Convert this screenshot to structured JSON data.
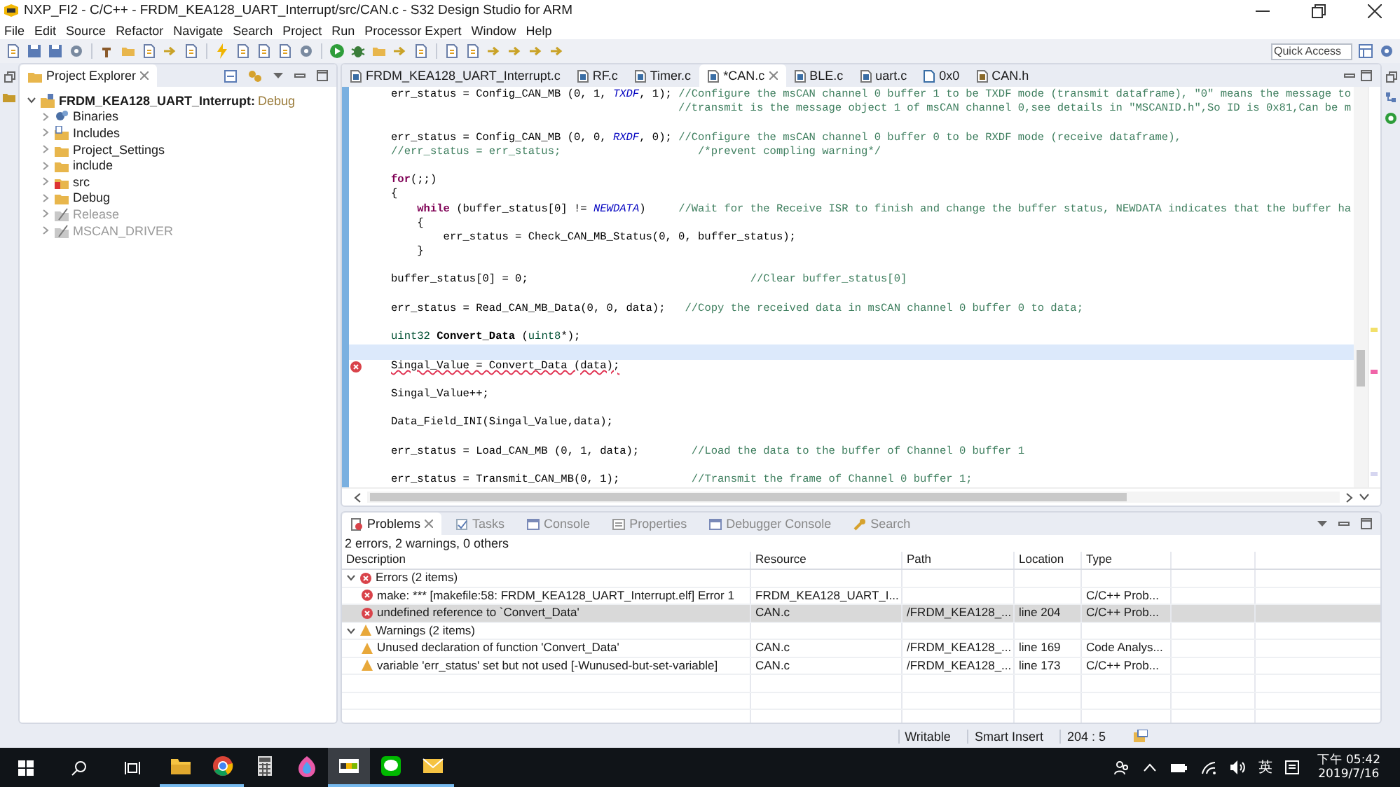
{
  "window": {
    "title": "NXP_FI2 - C/C++ - FRDM_KEA128_UART_Interrupt/src/CAN.c - S32 Design Studio for ARM"
  },
  "menu": [
    "File",
    "Edit",
    "Source",
    "Refactor",
    "Navigate",
    "Search",
    "Project",
    "Run",
    "Processor Expert",
    "Window",
    "Help"
  ],
  "quick_access": {
    "placeholder": "Quick Access"
  },
  "project_explorer": {
    "title": "Project Explorer",
    "root": {
      "label": "FRDM_KEA128_UART_Interrupt:",
      "config": "Debug",
      "expanded": true,
      "children": [
        {
          "label": "Binaries",
          "kind": "binaries",
          "disabled": false
        },
        {
          "label": "Includes",
          "kind": "includes",
          "disabled": false
        },
        {
          "label": "Project_Settings",
          "kind": "folder",
          "disabled": false
        },
        {
          "label": "include",
          "kind": "folder",
          "disabled": false
        },
        {
          "label": "src",
          "kind": "source",
          "disabled": false
        },
        {
          "label": "Debug",
          "kind": "folder",
          "disabled": false
        },
        {
          "label": "Release",
          "kind": "excluded",
          "disabled": true
        },
        {
          "label": "MSCAN_DRIVER",
          "kind": "excluded",
          "disabled": true
        }
      ]
    }
  },
  "editor": {
    "tabs": [
      {
        "label": "FRDM_KEA128_UART_Interrupt.c",
        "kind": "source",
        "selected": false
      },
      {
        "label": "RF.c",
        "kind": "source",
        "selected": false
      },
      {
        "label": "Timer.c",
        "kind": "source",
        "selected": false
      },
      {
        "label": "*CAN.c",
        "kind": "source",
        "selected": true
      },
      {
        "label": "BLE.c",
        "kind": "source",
        "selected": false
      },
      {
        "label": "uart.c",
        "kind": "source",
        "selected": false
      },
      {
        "label": "0x0",
        "kind": "binary",
        "selected": false
      },
      {
        "label": "CAN.h",
        "kind": "header",
        "selected": false
      }
    ],
    "lines": [
      {
        "kind": "code",
        "current": false,
        "error": false,
        "segments": [
          {
            "kind": "text",
            "t": "err_status = Config_CAN_MB (0, 1, "
          },
          {
            "kind": "macro",
            "t": "TXDF"
          },
          {
            "kind": "text",
            "t": ", 1); "
          },
          {
            "kind": "comment",
            "t": "//Configure the msCAN channel 0 buffer 1 to be TXDF mode (transmit dataframe), \"0\" means the message to"
          }
        ]
      },
      {
        "kind": "code",
        "current": false,
        "error": false,
        "segments": [
          {
            "kind": "comment",
            "t": "                                            //transmit is the message object 1 of msCAN channel 0,see details in \"MSCANID.h\",So ID is 0x81,Can be m"
          }
        ]
      },
      {
        "kind": "blank",
        "current": false,
        "error": false
      },
      {
        "kind": "code",
        "current": false,
        "error": false,
        "segments": [
          {
            "kind": "text",
            "t": "err_status = Config_CAN_MB (0, 0, "
          },
          {
            "kind": "macro",
            "t": "RXDF"
          },
          {
            "kind": "text",
            "t": ", 0); "
          },
          {
            "kind": "comment",
            "t": "//Configure the msCAN channel 0 buffer 0 to be RXDF mode (receive dataframe),"
          }
        ]
      },
      {
        "kind": "code",
        "current": false,
        "error": false,
        "segments": [
          {
            "kind": "comment",
            "t": "//err_status = err_status;                     /*prevent compling warning*/"
          }
        ]
      },
      {
        "kind": "blank",
        "current": false,
        "error": false
      },
      {
        "kind": "code",
        "current": false,
        "error": false,
        "segments": [
          {
            "kind": "keyword",
            "t": "for"
          },
          {
            "kind": "text",
            "t": "(;;)"
          }
        ]
      },
      {
        "kind": "code",
        "current": false,
        "error": false,
        "segments": [
          {
            "kind": "text",
            "t": "{"
          }
        ]
      },
      {
        "kind": "code",
        "current": false,
        "error": false,
        "segments": [
          {
            "kind": "keyword",
            "t": "    while"
          },
          {
            "kind": "text",
            "t": " (buffer_status[0] != "
          },
          {
            "kind": "macro",
            "t": "NEWDATA"
          },
          {
            "kind": "text",
            "t": ")     "
          },
          {
            "kind": "comment",
            "t": "//Wait for the Receive ISR to finish and change the buffer status, NEWDATA indicates that the buffer ha"
          }
        ]
      },
      {
        "kind": "code",
        "current": false,
        "error": false,
        "segments": [
          {
            "kind": "text",
            "t": "    {"
          }
        ]
      },
      {
        "kind": "code",
        "current": false,
        "error": false,
        "segments": [
          {
            "kind": "text",
            "t": "        err_status = Check_CAN_MB_Status(0, 0, buffer_status);"
          }
        ]
      },
      {
        "kind": "code",
        "current": false,
        "error": false,
        "segments": [
          {
            "kind": "text",
            "t": "    }"
          }
        ]
      },
      {
        "kind": "blank",
        "current": false,
        "error": false
      },
      {
        "kind": "code",
        "current": false,
        "error": false,
        "segments": [
          {
            "kind": "text",
            "t": "buffer_status[0] = 0;                                  "
          },
          {
            "kind": "comment",
            "t": "//Clear buffer_status[0]"
          }
        ]
      },
      {
        "kind": "blank",
        "current": false,
        "error": false
      },
      {
        "kind": "code",
        "current": false,
        "error": false,
        "segments": [
          {
            "kind": "text",
            "t": "err_status = Read_CAN_MB_Data(0, 0, data);   "
          },
          {
            "kind": "comment",
            "t": "//Copy the received data in msCAN channel 0 buffer 0 to data;"
          }
        ]
      },
      {
        "kind": "blank",
        "current": false,
        "error": false
      },
      {
        "kind": "code",
        "current": false,
        "error": false,
        "segments": [
          {
            "kind": "type",
            "t": "uint32 "
          },
          {
            "kind": "bold",
            "t": "Convert_Data"
          },
          {
            "kind": "text",
            "t": " ("
          },
          {
            "kind": "type",
            "t": "uint8"
          },
          {
            "kind": "text",
            "t": "*);"
          }
        ]
      },
      {
        "kind": "blank",
        "current": true,
        "error": false
      },
      {
        "kind": "code",
        "current": false,
        "error": true,
        "segments": [
          {
            "kind": "text",
            "t": "Singal_Value = Convert_Data (data);"
          }
        ]
      },
      {
        "kind": "blank",
        "current": false,
        "error": false
      },
      {
        "kind": "code",
        "current": false,
        "error": false,
        "segments": [
          {
            "kind": "text",
            "t": "Singal_Value++;"
          }
        ]
      },
      {
        "kind": "blank",
        "current": false,
        "error": false
      },
      {
        "kind": "code",
        "current": false,
        "error": false,
        "segments": [
          {
            "kind": "text",
            "t": "Data_Field_INI(Singal_Value,data);"
          }
        ]
      },
      {
        "kind": "blank",
        "current": false,
        "error": false
      },
      {
        "kind": "code",
        "current": false,
        "error": false,
        "segments": [
          {
            "kind": "text",
            "t": "err_status = Load_CAN_MB (0, 1, data);        "
          },
          {
            "kind": "comment",
            "t": "//Load the data to the buffer of Channel 0 buffer 1"
          }
        ]
      },
      {
        "kind": "blank",
        "current": false,
        "error": false
      },
      {
        "kind": "code",
        "current": false,
        "error": false,
        "segments": [
          {
            "kind": "text",
            "t": "err_status = Transmit_CAN_MB(0, 1);           "
          },
          {
            "kind": "comment",
            "t": "//Transmit the frame of Channel 0 buffer 1;"
          }
        ]
      }
    ]
  },
  "problems": {
    "tabs": [
      {
        "label": "Problems",
        "kind": "problems",
        "selected": true
      },
      {
        "label": "Tasks",
        "kind": "tasks",
        "selected": false
      },
      {
        "label": "Console",
        "kind": "console",
        "selected": false
      },
      {
        "label": "Properties",
        "kind": "properties",
        "selected": false
      },
      {
        "label": "Debugger Console",
        "kind": "console",
        "selected": false
      },
      {
        "label": "Search",
        "kind": "search",
        "selected": false
      }
    ],
    "summary": "2 errors, 2 warnings, 0 others",
    "columns": [
      "Description",
      "Resource",
      "Path",
      "Location",
      "Type"
    ],
    "groups": [
      {
        "label": "Errors (2 items)",
        "kind": "error",
        "expanded": true,
        "items": [
          {
            "description": "make: *** [makefile:58: FRDM_KEA128_UART_Interrupt.elf] Error 1",
            "resource": "FRDM_KEA128_UART_I...",
            "type": "C/C++ Prob...",
            "selected": false
          },
          {
            "description": "undefined reference to `Convert_Data'",
            "resource": "CAN.c",
            "path": "/FRDM_KEA128_...",
            "location": "line 204",
            "type": "C/C++ Prob...",
            "selected": true
          }
        ]
      },
      {
        "label": "Warnings (2 items)",
        "kind": "warning",
        "expanded": true,
        "items": [
          {
            "description": "Unused declaration of function 'Convert_Data'",
            "resource": "CAN.c",
            "path": "/FRDM_KEA128_...",
            "location": "line 169",
            "type": "Code Analys...",
            "selected": false
          },
          {
            "description": "variable 'err_status' set but not used [-Wunused-but-set-variable]",
            "resource": "CAN.c",
            "path": "/FRDM_KEA128_...",
            "location": "line 173",
            "type": "C/C++ Prob...",
            "selected": false
          }
        ]
      }
    ]
  },
  "status_bar": [
    "Writable",
    "Smart Insert",
    "204 : 5"
  ],
  "taskbar": {
    "apps": [
      {
        "kind": "explorer",
        "running": true,
        "active": false
      },
      {
        "kind": "chrome",
        "running": true,
        "active": false
      },
      {
        "kind": "calculator",
        "running": false,
        "active": false
      },
      {
        "kind": "paint",
        "running": false,
        "active": false
      },
      {
        "kind": "nxp",
        "running": true,
        "active": true
      },
      {
        "kind": "line",
        "running": true,
        "active": false
      },
      {
        "kind": "mail",
        "running": true,
        "active": false
      }
    ],
    "ime": "英",
    "time": "下午 05:42",
    "date": "2019/7/16"
  }
}
